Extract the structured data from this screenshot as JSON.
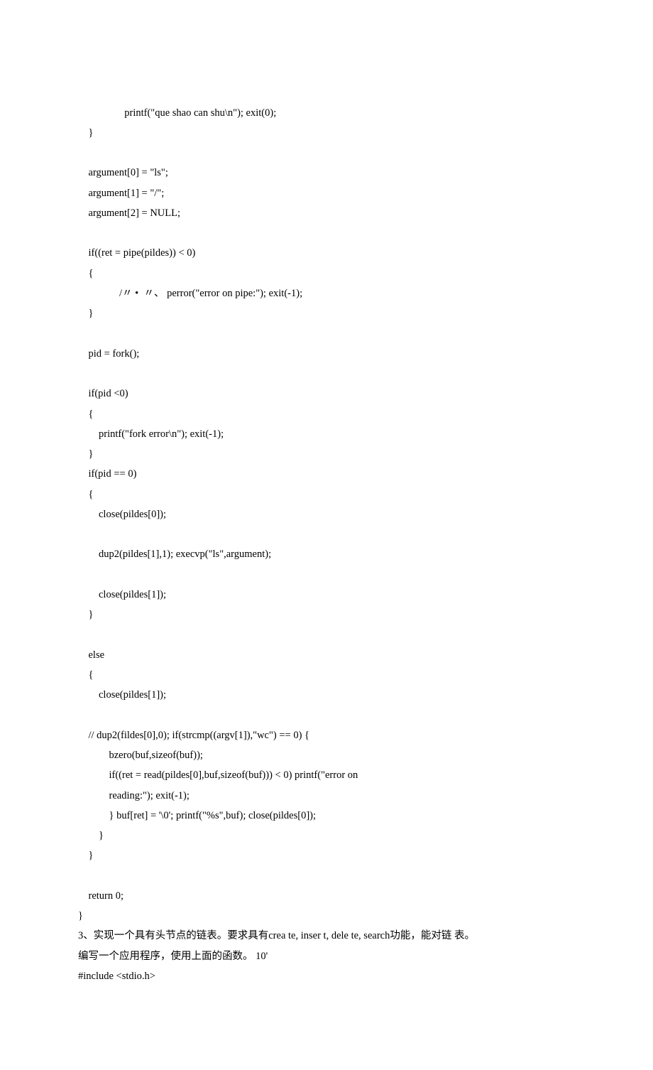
{
  "lines": [
    {
      "indent": 18,
      "text": "printf(\"que shao can shu\\n\"); exit(0);"
    },
    {
      "indent": 4,
      "text": "}"
    },
    {
      "indent": 4,
      "text": ""
    },
    {
      "indent": 4,
      "text": "argument[0] = \"ls\";"
    },
    {
      "indent": 4,
      "text": "argument[1] = \"/\";"
    },
    {
      "indent": 4,
      "text": "argument[2] = NULL;"
    },
    {
      "indent": 4,
      "text": ""
    },
    {
      "indent": 4,
      "text": "if((ret = pipe(pildes)) < 0)"
    },
    {
      "indent": 4,
      "text": "{"
    },
    {
      "indent": 16,
      "text": "/〃 •  〃、 perror(\"error on pipe:\"); exit(-1);"
    },
    {
      "indent": 4,
      "text": "}"
    },
    {
      "indent": 4,
      "text": ""
    },
    {
      "indent": 4,
      "text": "pid = fork();"
    },
    {
      "indent": 4,
      "text": ""
    },
    {
      "indent": 4,
      "text": "if(pid <0)"
    },
    {
      "indent": 4,
      "text": "{"
    },
    {
      "indent": 8,
      "text": "printf(\"fork error\\n\"); exit(-1);"
    },
    {
      "indent": 4,
      "text": "}"
    },
    {
      "indent": 4,
      "text": "if(pid == 0)"
    },
    {
      "indent": 4,
      "text": "{"
    },
    {
      "indent": 8,
      "text": "close(pildes[0]);"
    },
    {
      "indent": 8,
      "text": ""
    },
    {
      "indent": 8,
      "text": "dup2(pildes[1],1); execvp(\"ls\",argument);"
    },
    {
      "indent": 8,
      "text": ""
    },
    {
      "indent": 8,
      "text": "close(pildes[1]);"
    },
    {
      "indent": 4,
      "text": "}"
    },
    {
      "indent": 4,
      "text": ""
    },
    {
      "indent": 4,
      "text": "else"
    },
    {
      "indent": 4,
      "text": "{"
    },
    {
      "indent": 8,
      "text": "close(pildes[1]);"
    },
    {
      "indent": 8,
      "text": ""
    },
    {
      "indent": 4,
      "text": "// dup2(fildes[0],0); if(strcmp((argv[1]),\"wc\") == 0) {"
    },
    {
      "indent": 12,
      "text": "bzero(buf,sizeof(buf));"
    },
    {
      "indent": 12,
      "text": "if((ret = read(pildes[0],buf,sizeof(buf))) < 0) printf(\"error on "
    },
    {
      "indent": 12,
      "text": "reading:\"); exit(-1);"
    },
    {
      "indent": 12,
      "text": "} buf[ret] = '\\0'; printf(\"%s\",buf); close(pildes[0]);"
    },
    {
      "indent": 8,
      "text": "}"
    },
    {
      "indent": 4,
      "text": "}"
    },
    {
      "indent": 4,
      "text": ""
    },
    {
      "indent": 4,
      "text": "return 0;"
    },
    {
      "indent": 0,
      "text": "}"
    },
    {
      "indent": 0,
      "text": "3、实现一个具有头节点的链表。要求具有crea te, inser t, dele te, search功能，能对链 表。"
    },
    {
      "indent": 0,
      "text": "编写一个应用程序，使用上面的函数。 10'"
    },
    {
      "indent": 0,
      "text": "#include <stdio.h>"
    }
  ]
}
